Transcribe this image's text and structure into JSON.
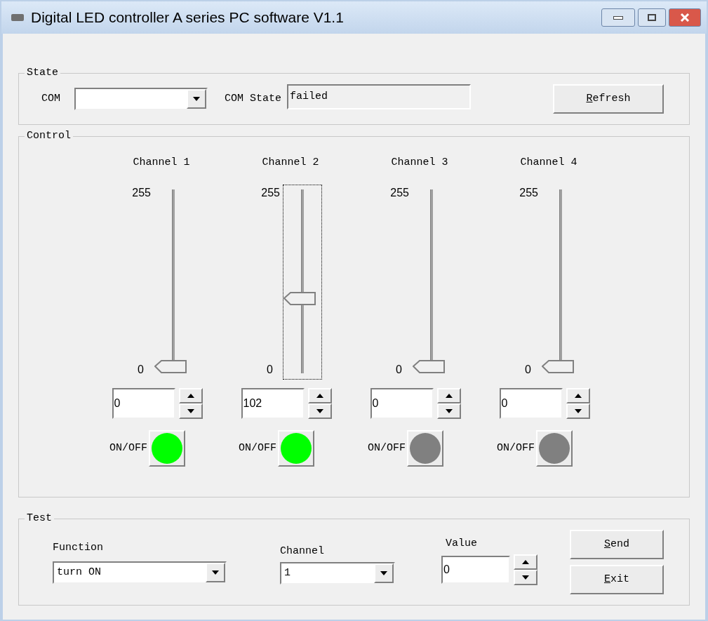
{
  "window": {
    "title": "Digital LED controller A series PC software V1.1"
  },
  "state": {
    "title": "State",
    "com_label": "COM",
    "com_state_label": "COM State",
    "com_state_value": "failed",
    "refresh": "Refresh"
  },
  "control": {
    "title": "Control",
    "channels": [
      {
        "label": "Channel 1",
        "max": "255",
        "min": "0",
        "level": 0,
        "value": "0",
        "focused": false,
        "on_label": "ON/OFF",
        "on": true
      },
      {
        "label": "Channel 2",
        "max": "255",
        "min": "0",
        "level": 0.4,
        "value": "102",
        "focused": true,
        "on_label": "ON/OFF",
        "on": true
      },
      {
        "label": "Channel 3",
        "max": "255",
        "min": "0",
        "level": 0,
        "value": "0",
        "focused": false,
        "on_label": "ON/OFF",
        "on": false
      },
      {
        "label": "Channel 4",
        "max": "255",
        "min": "0",
        "level": 0,
        "value": "0",
        "focused": false,
        "on_label": "ON/OFF",
        "on": false
      }
    ]
  },
  "test": {
    "title": "Test",
    "function_label": "Function",
    "function_value": "turn ON",
    "channel_label": "Channel",
    "channel_value": "1",
    "value_label": "Value",
    "value_value": "0",
    "send": "Send",
    "exit": "Exit"
  }
}
